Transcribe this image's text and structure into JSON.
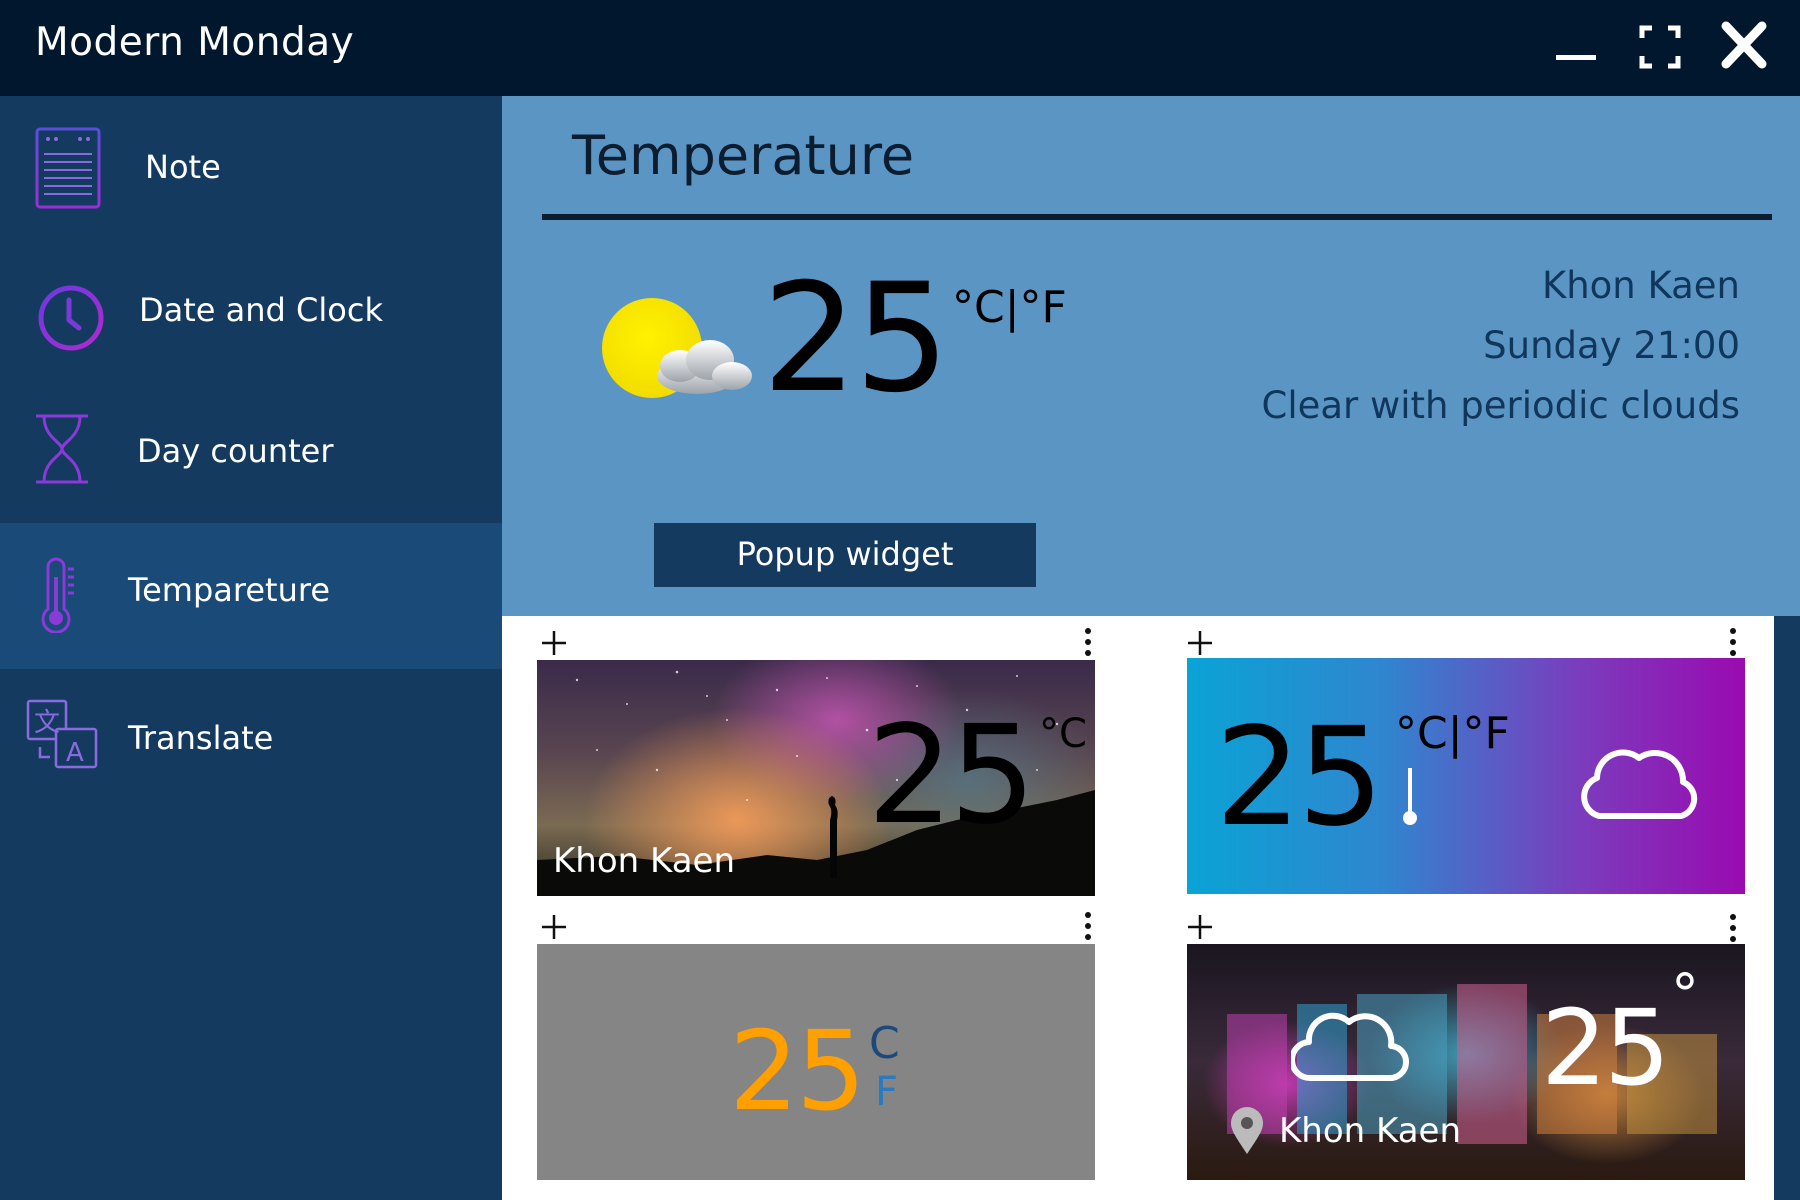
{
  "window": {
    "title": "Modern Monday",
    "minimize_icon": "minimize-icon",
    "maximize_icon": "maximize-icon",
    "close_icon": "close-icon"
  },
  "sidebar": {
    "items": [
      {
        "label": "Note",
        "icon": "note-icon",
        "active": false
      },
      {
        "label": "Date and Clock",
        "icon": "clock-icon",
        "active": false
      },
      {
        "label": "Day counter",
        "icon": "hourglass-icon",
        "active": false
      },
      {
        "label": "Tempareture",
        "icon": "thermometer-icon",
        "active": true
      },
      {
        "label": "Translate",
        "icon": "translate-icon",
        "active": false
      }
    ]
  },
  "main": {
    "title": "Temperature",
    "current": {
      "temp": "25",
      "unit": "°C|°F",
      "icon": "sun-cloud-icon",
      "city": "Khon Kaen",
      "day_time": "Sunday 21:00",
      "condition": "Clear with periodic clouds"
    },
    "popup_button": "Popup widget"
  },
  "widgets": [
    {
      "style": "night-sky",
      "temp": "25",
      "unit": "°C",
      "city": "Khon Kaen"
    },
    {
      "style": "gradient",
      "temp": "25",
      "unit": "°C|°F",
      "icon": "cloud-icon"
    },
    {
      "style": "gray",
      "temp": "25",
      "unit_c": "C",
      "unit_f": "F"
    },
    {
      "style": "city-lights",
      "temp": "25",
      "unit": "°",
      "city": "Khon Kaen",
      "icon": "cloud-icon"
    }
  ],
  "colors": {
    "titlebar": "#01172e",
    "sidebar": "#143a60",
    "sidebar_active": "#1a4a78",
    "header_panel": "#5b95c4",
    "accent_purple": "#8a2be2",
    "gray_card_temp": "#ff9f00",
    "gray_card_unit": "#1b5a99"
  }
}
